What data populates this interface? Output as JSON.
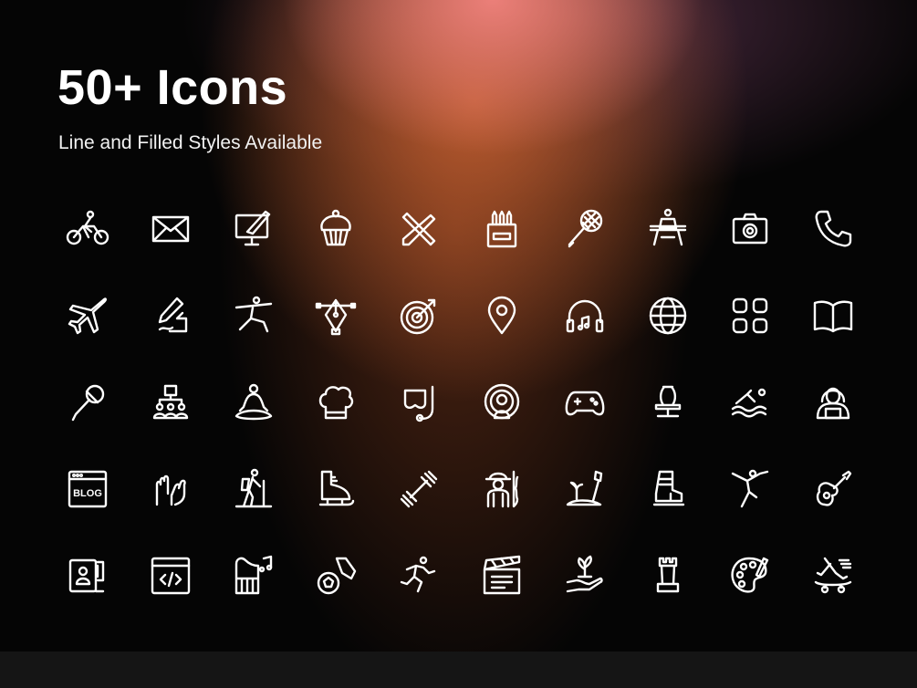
{
  "header": {
    "title": "50+ Icons",
    "subtitle": "Line and Filled Styles Available"
  },
  "colors": {
    "background": "#050505",
    "icon_stroke": "#ffffff",
    "glow_top": "#f0827d",
    "glow_mid": "#cd6432",
    "footer": "#151515"
  },
  "icons": [
    {
      "name": "cycling-icon"
    },
    {
      "name": "mail-icon"
    },
    {
      "name": "digital-painting-icon"
    },
    {
      "name": "cupcake-icon"
    },
    {
      "name": "pencil-ruler-icon"
    },
    {
      "name": "crayons-icon"
    },
    {
      "name": "tennis-racket-icon"
    },
    {
      "name": "gymnast-icon"
    },
    {
      "name": "camera-icon"
    },
    {
      "name": "phone-icon"
    },
    {
      "name": "airplane-icon"
    },
    {
      "name": "signature-icon"
    },
    {
      "name": "yoga-warrior-icon"
    },
    {
      "name": "pen-tool-icon"
    },
    {
      "name": "target-icon"
    },
    {
      "name": "location-pin-icon"
    },
    {
      "name": "headphones-icon"
    },
    {
      "name": "globe-icon"
    },
    {
      "name": "apps-grid-icon"
    },
    {
      "name": "open-book-icon"
    },
    {
      "name": "microphone-icon"
    },
    {
      "name": "team-icon"
    },
    {
      "name": "meditation-icon"
    },
    {
      "name": "chef-hat-icon"
    },
    {
      "name": "snorkel-mask-icon"
    },
    {
      "name": "live-stream-icon"
    },
    {
      "name": "gamepad-icon"
    },
    {
      "name": "pottery-icon"
    },
    {
      "name": "swimming-icon"
    },
    {
      "name": "hacker-icon"
    },
    {
      "name": "blog-icon",
      "label": "BLOG"
    },
    {
      "name": "high-five-icon"
    },
    {
      "name": "hiking-icon"
    },
    {
      "name": "ice-skate-icon"
    },
    {
      "name": "dumbbell-icon"
    },
    {
      "name": "climber-icon"
    },
    {
      "name": "gardening-icon"
    },
    {
      "name": "ski-boot-icon"
    },
    {
      "name": "ballet-icon"
    },
    {
      "name": "guitar-icon"
    },
    {
      "name": "selfie-stick-icon"
    },
    {
      "name": "code-window-icon"
    },
    {
      "name": "piano-icon"
    },
    {
      "name": "soccer-icon"
    },
    {
      "name": "running-icon"
    },
    {
      "name": "clapperboard-icon"
    },
    {
      "name": "plant-hand-icon"
    },
    {
      "name": "chess-rook-icon"
    },
    {
      "name": "palette-icon"
    },
    {
      "name": "skateboard-icon"
    }
  ]
}
